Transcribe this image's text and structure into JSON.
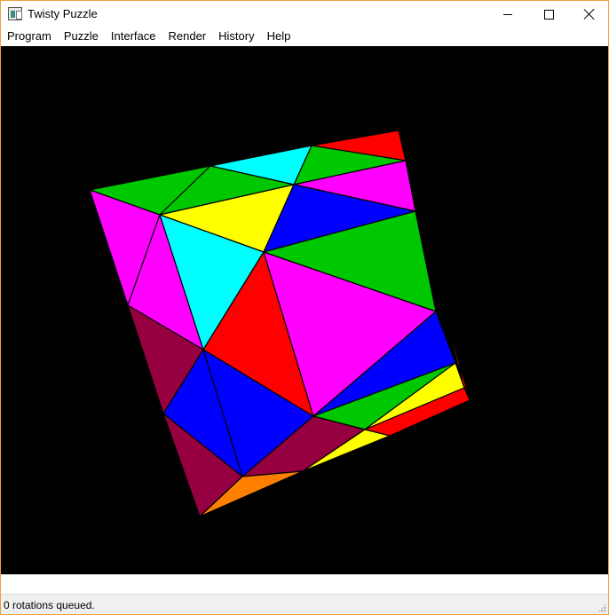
{
  "window": {
    "title": "Twisty Puzzle",
    "minimize_icon": "minimize-icon",
    "maximize_icon": "maximize-icon",
    "close_icon": "close-icon"
  },
  "menu": {
    "items": [
      "Program",
      "Puzzle",
      "Interface",
      "Render",
      "History",
      "Help"
    ]
  },
  "viewport": {
    "background": "#000000",
    "puzzle_colors": {
      "green": "#00c800",
      "cyan": "#00ffff",
      "red": "#ff0000",
      "magenta": "#ff00ff",
      "yellow": "#ffff00",
      "blue": "#0000ff",
      "maroon": "#960040",
      "orange": "#ff8000"
    }
  },
  "command_input": {
    "value": ""
  },
  "status": {
    "text": "0 rotations queued."
  }
}
